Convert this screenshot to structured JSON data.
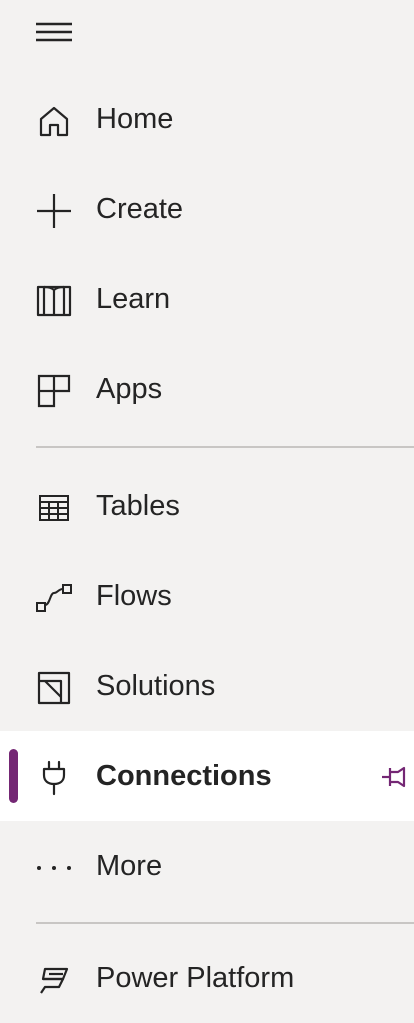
{
  "nav": {
    "menu_icon": "hamburger-icon",
    "items": [
      {
        "label": "Home",
        "icon": "home-icon"
      },
      {
        "label": "Create",
        "icon": "plus-icon"
      },
      {
        "label": "Learn",
        "icon": "book-icon"
      },
      {
        "label": "Apps",
        "icon": "apps-icon"
      },
      {
        "label": "Tables",
        "icon": "table-icon"
      },
      {
        "label": "Flows",
        "icon": "flow-icon"
      },
      {
        "label": "Solutions",
        "icon": "solutions-icon"
      },
      {
        "label": "Connections",
        "icon": "plug-icon",
        "selected": true
      },
      {
        "label": "More",
        "icon": "ellipsis-icon"
      },
      {
        "label": "Power Platform",
        "icon": "power-platform-icon"
      }
    ],
    "pin_icon": "pin-icon"
  },
  "colors": {
    "background": "#f3f2f1",
    "selected_background": "#ffffff",
    "accent": "#742774",
    "text": "#242424",
    "divider": "#c8c6c4"
  }
}
